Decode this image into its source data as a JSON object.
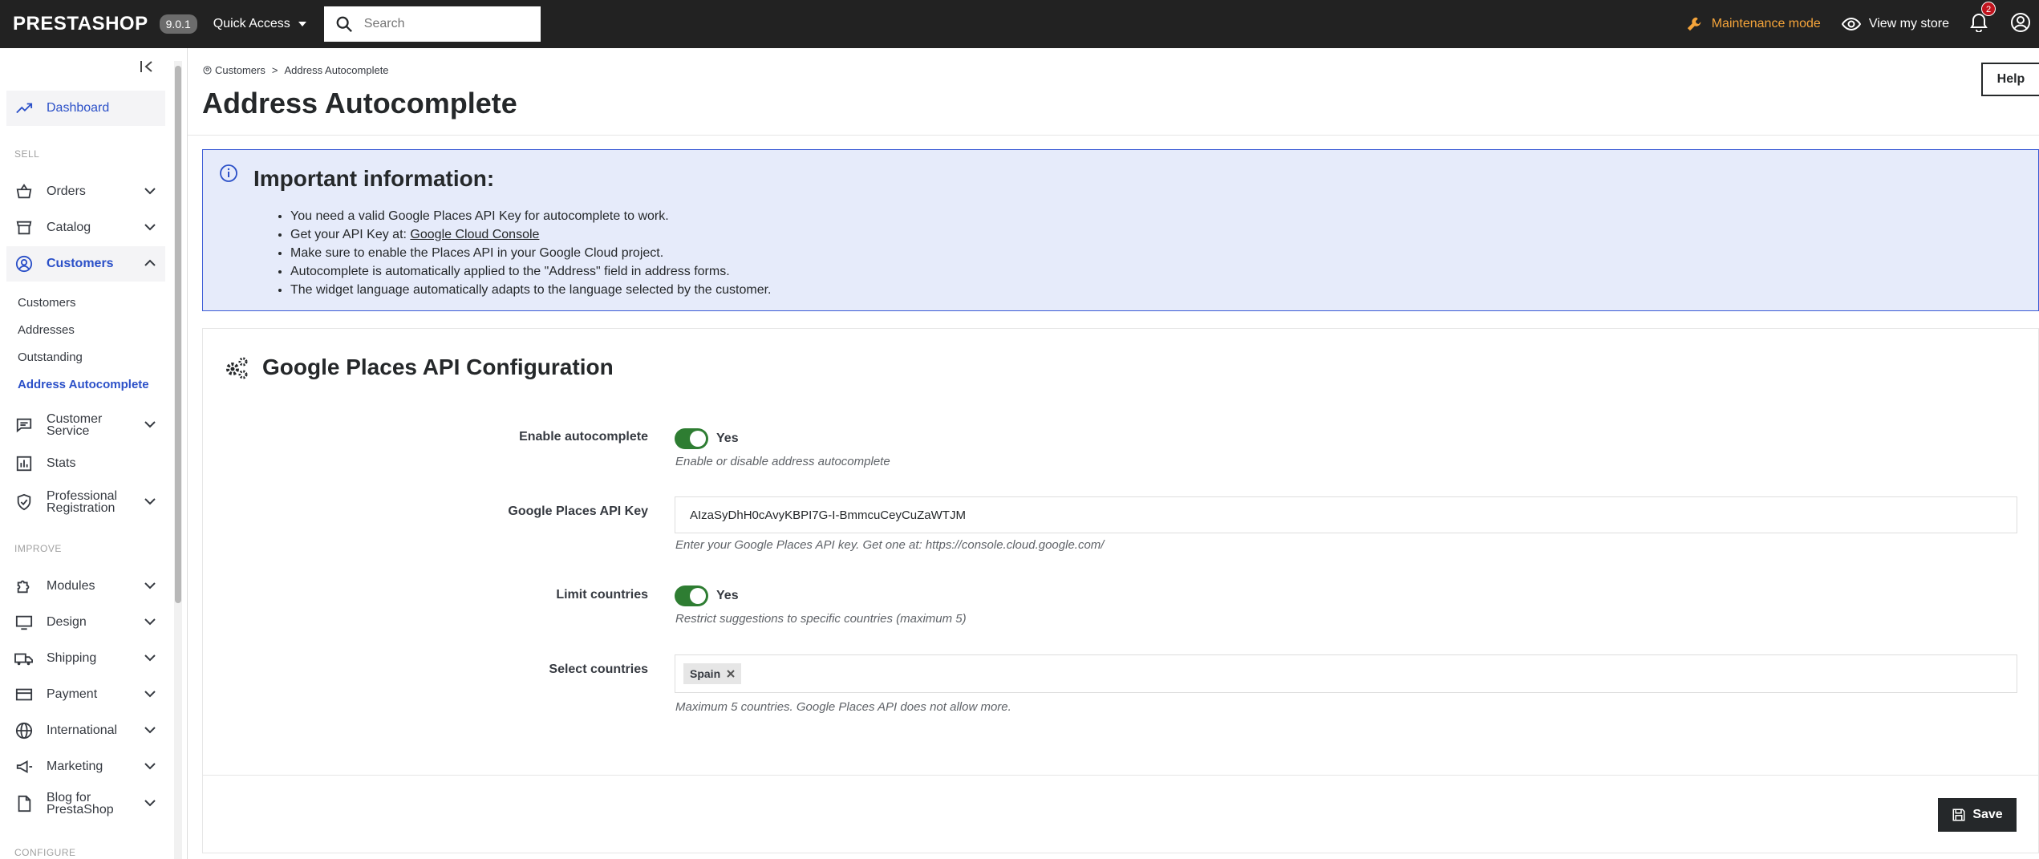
{
  "topbar": {
    "logo": "PRESTASHOP",
    "version": "9.0.1",
    "quick_access": "Quick Access",
    "search_placeholder": "Search",
    "maintenance": "Maintenance mode",
    "view_store": "View my store",
    "notifications_count": "2",
    "maintenance_color": "#f5a43a"
  },
  "sidebar": {
    "dashboard": "Dashboard",
    "sell_label": "SELL",
    "orders": "Orders",
    "catalog": "Catalog",
    "customers": "Customers",
    "sub": {
      "customers": "Customers",
      "addresses": "Addresses",
      "outstanding": "Outstanding",
      "address_autocomplete": "Address Autocomplete"
    },
    "customer_service": [
      "Customer",
      "Service"
    ],
    "stats": "Stats",
    "professional_registration": [
      "Professional",
      "Registration"
    ],
    "improve_label": "IMPROVE",
    "modules": "Modules",
    "design": "Design",
    "shipping": "Shipping",
    "payment": "Payment",
    "international": "International",
    "marketing": "Marketing",
    "blog": [
      "Blog for",
      "PrestaShop"
    ],
    "configure_label": "CONFIGURE",
    "active_color": "#2b50c8"
  },
  "header": {
    "breadcrumb_parent": "Customers",
    "breadcrumb_separator": ">",
    "breadcrumb_current": "Address Autocomplete",
    "title": "Address Autocomplete",
    "help": "Help"
  },
  "info": {
    "title": "Important information:",
    "items": [
      "You need a valid Google Places API Key for autocomplete to work.",
      "Make sure to enable the Places API in your Google Cloud project.",
      "Autocomplete is automatically applied to the \"Address\" field in address forms.",
      "The widget language automatically adapts to the language selected by the customer."
    ],
    "api_key_prefix": "Get your API Key at:",
    "api_key_link": "Google Cloud Console"
  },
  "config": {
    "title": "Google Places API Configuration",
    "enable_label": "Enable autocomplete",
    "enable_value": "Yes",
    "enable_help": "Enable or disable address autocomplete",
    "api_key_label": "Google Places API Key",
    "api_key_value": "AIzaSyDhH0cAvyKBPI7G-I-BmmcuCeyCuZaWTJM",
    "api_key_help": "Enter your Google Places API key. Get one at: https://console.cloud.google.com/",
    "limit_label": "Limit countries",
    "limit_value": "Yes",
    "limit_help": "Restrict suggestions to specific countries (maximum 5)",
    "countries_label": "Select countries",
    "countries": [
      "Spain"
    ],
    "countries_help": "Maximum 5 countries. Google Places API does not allow more.",
    "save": "Save",
    "toggle_color": "#2e7d32"
  }
}
